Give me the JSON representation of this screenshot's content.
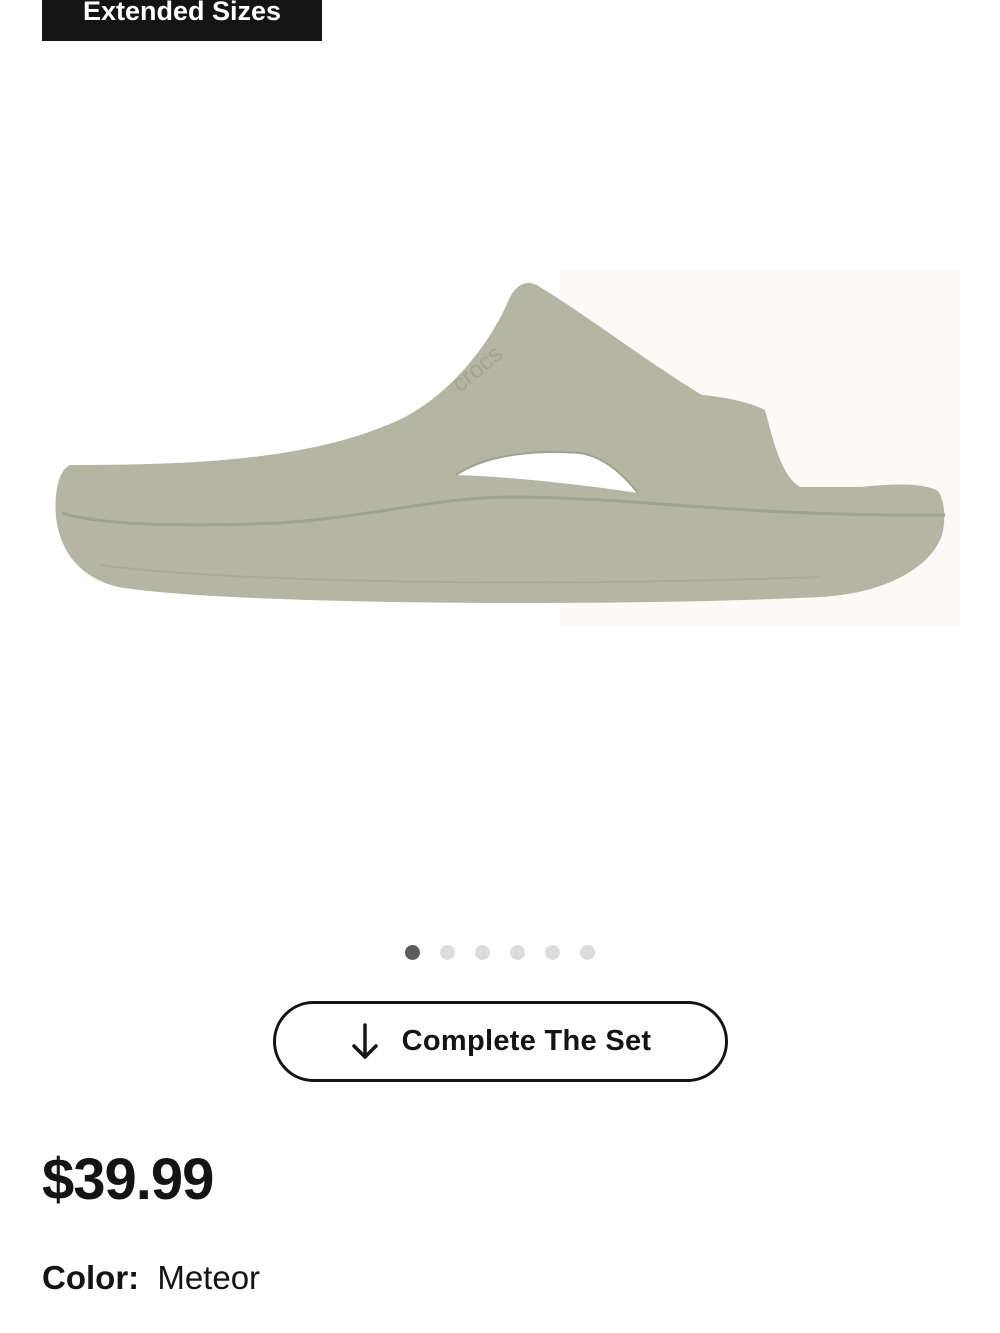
{
  "badge": {
    "label": "Extended Sizes"
  },
  "gallery": {
    "image_icon": "slide-sandal-image",
    "brand_emboss": "crocs",
    "dot_count": 6,
    "active_dot": 1
  },
  "complete_set": {
    "icon": "arrow-down-icon",
    "label": "Complete The Set"
  },
  "product": {
    "price": "$39.99",
    "color_label": "Color:",
    "color_value": "Meteor"
  },
  "colors": {
    "text": "#141414",
    "badge_bg": "#141414",
    "badge_text": "#ffffff",
    "dot_active": "#5c5c5c",
    "dot_inactive": "#dcdcdc",
    "sandal": "#b4b6a3"
  }
}
